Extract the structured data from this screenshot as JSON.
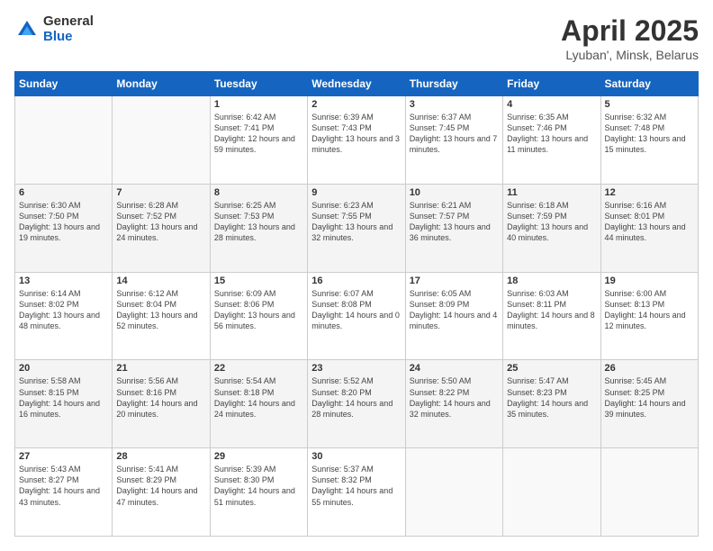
{
  "logo": {
    "general": "General",
    "blue": "Blue"
  },
  "title": "April 2025",
  "subtitle": "Lyuban', Minsk, Belarus",
  "days_of_week": [
    "Sunday",
    "Monday",
    "Tuesday",
    "Wednesday",
    "Thursday",
    "Friday",
    "Saturday"
  ],
  "weeks": [
    [
      {
        "day": "",
        "info": ""
      },
      {
        "day": "",
        "info": ""
      },
      {
        "day": "1",
        "info": "Sunrise: 6:42 AM\nSunset: 7:41 PM\nDaylight: 12 hours and 59 minutes."
      },
      {
        "day": "2",
        "info": "Sunrise: 6:39 AM\nSunset: 7:43 PM\nDaylight: 13 hours and 3 minutes."
      },
      {
        "day": "3",
        "info": "Sunrise: 6:37 AM\nSunset: 7:45 PM\nDaylight: 13 hours and 7 minutes."
      },
      {
        "day": "4",
        "info": "Sunrise: 6:35 AM\nSunset: 7:46 PM\nDaylight: 13 hours and 11 minutes."
      },
      {
        "day": "5",
        "info": "Sunrise: 6:32 AM\nSunset: 7:48 PM\nDaylight: 13 hours and 15 minutes."
      }
    ],
    [
      {
        "day": "6",
        "info": "Sunrise: 6:30 AM\nSunset: 7:50 PM\nDaylight: 13 hours and 19 minutes."
      },
      {
        "day": "7",
        "info": "Sunrise: 6:28 AM\nSunset: 7:52 PM\nDaylight: 13 hours and 24 minutes."
      },
      {
        "day": "8",
        "info": "Sunrise: 6:25 AM\nSunset: 7:53 PM\nDaylight: 13 hours and 28 minutes."
      },
      {
        "day": "9",
        "info": "Sunrise: 6:23 AM\nSunset: 7:55 PM\nDaylight: 13 hours and 32 minutes."
      },
      {
        "day": "10",
        "info": "Sunrise: 6:21 AM\nSunset: 7:57 PM\nDaylight: 13 hours and 36 minutes."
      },
      {
        "day": "11",
        "info": "Sunrise: 6:18 AM\nSunset: 7:59 PM\nDaylight: 13 hours and 40 minutes."
      },
      {
        "day": "12",
        "info": "Sunrise: 6:16 AM\nSunset: 8:01 PM\nDaylight: 13 hours and 44 minutes."
      }
    ],
    [
      {
        "day": "13",
        "info": "Sunrise: 6:14 AM\nSunset: 8:02 PM\nDaylight: 13 hours and 48 minutes."
      },
      {
        "day": "14",
        "info": "Sunrise: 6:12 AM\nSunset: 8:04 PM\nDaylight: 13 hours and 52 minutes."
      },
      {
        "day": "15",
        "info": "Sunrise: 6:09 AM\nSunset: 8:06 PM\nDaylight: 13 hours and 56 minutes."
      },
      {
        "day": "16",
        "info": "Sunrise: 6:07 AM\nSunset: 8:08 PM\nDaylight: 14 hours and 0 minutes."
      },
      {
        "day": "17",
        "info": "Sunrise: 6:05 AM\nSunset: 8:09 PM\nDaylight: 14 hours and 4 minutes."
      },
      {
        "day": "18",
        "info": "Sunrise: 6:03 AM\nSunset: 8:11 PM\nDaylight: 14 hours and 8 minutes."
      },
      {
        "day": "19",
        "info": "Sunrise: 6:00 AM\nSunset: 8:13 PM\nDaylight: 14 hours and 12 minutes."
      }
    ],
    [
      {
        "day": "20",
        "info": "Sunrise: 5:58 AM\nSunset: 8:15 PM\nDaylight: 14 hours and 16 minutes."
      },
      {
        "day": "21",
        "info": "Sunrise: 5:56 AM\nSunset: 8:16 PM\nDaylight: 14 hours and 20 minutes."
      },
      {
        "day": "22",
        "info": "Sunrise: 5:54 AM\nSunset: 8:18 PM\nDaylight: 14 hours and 24 minutes."
      },
      {
        "day": "23",
        "info": "Sunrise: 5:52 AM\nSunset: 8:20 PM\nDaylight: 14 hours and 28 minutes."
      },
      {
        "day": "24",
        "info": "Sunrise: 5:50 AM\nSunset: 8:22 PM\nDaylight: 14 hours and 32 minutes."
      },
      {
        "day": "25",
        "info": "Sunrise: 5:47 AM\nSunset: 8:23 PM\nDaylight: 14 hours and 35 minutes."
      },
      {
        "day": "26",
        "info": "Sunrise: 5:45 AM\nSunset: 8:25 PM\nDaylight: 14 hours and 39 minutes."
      }
    ],
    [
      {
        "day": "27",
        "info": "Sunrise: 5:43 AM\nSunset: 8:27 PM\nDaylight: 14 hours and 43 minutes."
      },
      {
        "day": "28",
        "info": "Sunrise: 5:41 AM\nSunset: 8:29 PM\nDaylight: 14 hours and 47 minutes."
      },
      {
        "day": "29",
        "info": "Sunrise: 5:39 AM\nSunset: 8:30 PM\nDaylight: 14 hours and 51 minutes."
      },
      {
        "day": "30",
        "info": "Sunrise: 5:37 AM\nSunset: 8:32 PM\nDaylight: 14 hours and 55 minutes."
      },
      {
        "day": "",
        "info": ""
      },
      {
        "day": "",
        "info": ""
      },
      {
        "day": "",
        "info": ""
      }
    ]
  ]
}
